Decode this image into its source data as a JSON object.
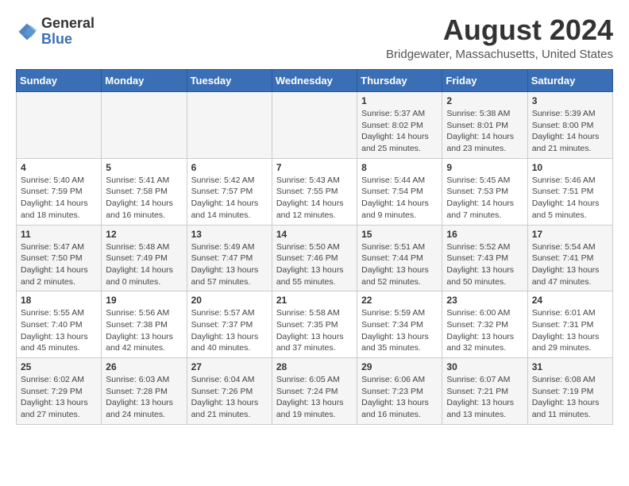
{
  "header": {
    "logo_general": "General",
    "logo_blue": "Blue",
    "month_year": "August 2024",
    "location": "Bridgewater, Massachusetts, United States"
  },
  "days_of_week": [
    "Sunday",
    "Monday",
    "Tuesday",
    "Wednesday",
    "Thursday",
    "Friday",
    "Saturday"
  ],
  "weeks": [
    [
      {
        "day": "",
        "sunrise": "",
        "sunset": "",
        "daylight": ""
      },
      {
        "day": "",
        "sunrise": "",
        "sunset": "",
        "daylight": ""
      },
      {
        "day": "",
        "sunrise": "",
        "sunset": "",
        "daylight": ""
      },
      {
        "day": "",
        "sunrise": "",
        "sunset": "",
        "daylight": ""
      },
      {
        "day": "1",
        "sunrise": "Sunrise: 5:37 AM",
        "sunset": "Sunset: 8:02 PM",
        "daylight": "Daylight: 14 hours and 25 minutes."
      },
      {
        "day": "2",
        "sunrise": "Sunrise: 5:38 AM",
        "sunset": "Sunset: 8:01 PM",
        "daylight": "Daylight: 14 hours and 23 minutes."
      },
      {
        "day": "3",
        "sunrise": "Sunrise: 5:39 AM",
        "sunset": "Sunset: 8:00 PM",
        "daylight": "Daylight: 14 hours and 21 minutes."
      }
    ],
    [
      {
        "day": "4",
        "sunrise": "Sunrise: 5:40 AM",
        "sunset": "Sunset: 7:59 PM",
        "daylight": "Daylight: 14 hours and 18 minutes."
      },
      {
        "day": "5",
        "sunrise": "Sunrise: 5:41 AM",
        "sunset": "Sunset: 7:58 PM",
        "daylight": "Daylight: 14 hours and 16 minutes."
      },
      {
        "day": "6",
        "sunrise": "Sunrise: 5:42 AM",
        "sunset": "Sunset: 7:57 PM",
        "daylight": "Daylight: 14 hours and 14 minutes."
      },
      {
        "day": "7",
        "sunrise": "Sunrise: 5:43 AM",
        "sunset": "Sunset: 7:55 PM",
        "daylight": "Daylight: 14 hours and 12 minutes."
      },
      {
        "day": "8",
        "sunrise": "Sunrise: 5:44 AM",
        "sunset": "Sunset: 7:54 PM",
        "daylight": "Daylight: 14 hours and 9 minutes."
      },
      {
        "day": "9",
        "sunrise": "Sunrise: 5:45 AM",
        "sunset": "Sunset: 7:53 PM",
        "daylight": "Daylight: 14 hours and 7 minutes."
      },
      {
        "day": "10",
        "sunrise": "Sunrise: 5:46 AM",
        "sunset": "Sunset: 7:51 PM",
        "daylight": "Daylight: 14 hours and 5 minutes."
      }
    ],
    [
      {
        "day": "11",
        "sunrise": "Sunrise: 5:47 AM",
        "sunset": "Sunset: 7:50 PM",
        "daylight": "Daylight: 14 hours and 2 minutes."
      },
      {
        "day": "12",
        "sunrise": "Sunrise: 5:48 AM",
        "sunset": "Sunset: 7:49 PM",
        "daylight": "Daylight: 14 hours and 0 minutes."
      },
      {
        "day": "13",
        "sunrise": "Sunrise: 5:49 AM",
        "sunset": "Sunset: 7:47 PM",
        "daylight": "Daylight: 13 hours and 57 minutes."
      },
      {
        "day": "14",
        "sunrise": "Sunrise: 5:50 AM",
        "sunset": "Sunset: 7:46 PM",
        "daylight": "Daylight: 13 hours and 55 minutes."
      },
      {
        "day": "15",
        "sunrise": "Sunrise: 5:51 AM",
        "sunset": "Sunset: 7:44 PM",
        "daylight": "Daylight: 13 hours and 52 minutes."
      },
      {
        "day": "16",
        "sunrise": "Sunrise: 5:52 AM",
        "sunset": "Sunset: 7:43 PM",
        "daylight": "Daylight: 13 hours and 50 minutes."
      },
      {
        "day": "17",
        "sunrise": "Sunrise: 5:54 AM",
        "sunset": "Sunset: 7:41 PM",
        "daylight": "Daylight: 13 hours and 47 minutes."
      }
    ],
    [
      {
        "day": "18",
        "sunrise": "Sunrise: 5:55 AM",
        "sunset": "Sunset: 7:40 PM",
        "daylight": "Daylight: 13 hours and 45 minutes."
      },
      {
        "day": "19",
        "sunrise": "Sunrise: 5:56 AM",
        "sunset": "Sunset: 7:38 PM",
        "daylight": "Daylight: 13 hours and 42 minutes."
      },
      {
        "day": "20",
        "sunrise": "Sunrise: 5:57 AM",
        "sunset": "Sunset: 7:37 PM",
        "daylight": "Daylight: 13 hours and 40 minutes."
      },
      {
        "day": "21",
        "sunrise": "Sunrise: 5:58 AM",
        "sunset": "Sunset: 7:35 PM",
        "daylight": "Daylight: 13 hours and 37 minutes."
      },
      {
        "day": "22",
        "sunrise": "Sunrise: 5:59 AM",
        "sunset": "Sunset: 7:34 PM",
        "daylight": "Daylight: 13 hours and 35 minutes."
      },
      {
        "day": "23",
        "sunrise": "Sunrise: 6:00 AM",
        "sunset": "Sunset: 7:32 PM",
        "daylight": "Daylight: 13 hours and 32 minutes."
      },
      {
        "day": "24",
        "sunrise": "Sunrise: 6:01 AM",
        "sunset": "Sunset: 7:31 PM",
        "daylight": "Daylight: 13 hours and 29 minutes."
      }
    ],
    [
      {
        "day": "25",
        "sunrise": "Sunrise: 6:02 AM",
        "sunset": "Sunset: 7:29 PM",
        "daylight": "Daylight: 13 hours and 27 minutes."
      },
      {
        "day": "26",
        "sunrise": "Sunrise: 6:03 AM",
        "sunset": "Sunset: 7:28 PM",
        "daylight": "Daylight: 13 hours and 24 minutes."
      },
      {
        "day": "27",
        "sunrise": "Sunrise: 6:04 AM",
        "sunset": "Sunset: 7:26 PM",
        "daylight": "Daylight: 13 hours and 21 minutes."
      },
      {
        "day": "28",
        "sunrise": "Sunrise: 6:05 AM",
        "sunset": "Sunset: 7:24 PM",
        "daylight": "Daylight: 13 hours and 19 minutes."
      },
      {
        "day": "29",
        "sunrise": "Sunrise: 6:06 AM",
        "sunset": "Sunset: 7:23 PM",
        "daylight": "Daylight: 13 hours and 16 minutes."
      },
      {
        "day": "30",
        "sunrise": "Sunrise: 6:07 AM",
        "sunset": "Sunset: 7:21 PM",
        "daylight": "Daylight: 13 hours and 13 minutes."
      },
      {
        "day": "31",
        "sunrise": "Sunrise: 6:08 AM",
        "sunset": "Sunset: 7:19 PM",
        "daylight": "Daylight: 13 hours and 11 minutes."
      }
    ]
  ]
}
